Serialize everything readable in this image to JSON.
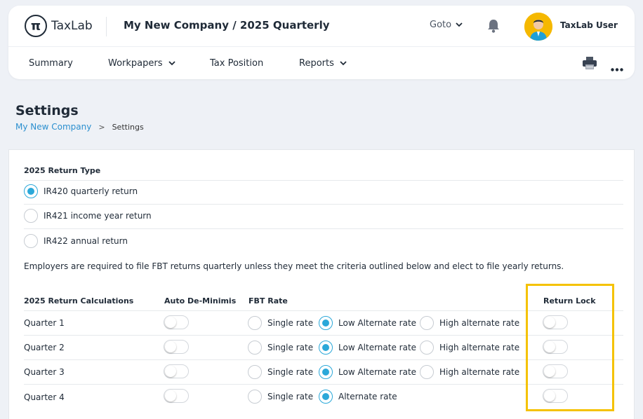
{
  "header": {
    "logo_text": "TaxLab",
    "logo_glyph": "π",
    "company_title": "My New Company / 2025 Quarterly",
    "goto_label": "Goto",
    "user_name": "TaxLab User",
    "avatar_color": "#f5b800"
  },
  "nav": {
    "items": [
      {
        "label": "Summary",
        "has_dropdown": false
      },
      {
        "label": "Workpapers",
        "has_dropdown": true
      },
      {
        "label": "Tax Position",
        "has_dropdown": false
      },
      {
        "label": "Reports",
        "has_dropdown": true
      }
    ],
    "icons": [
      "printer-icon",
      "more-icon"
    ]
  },
  "page": {
    "title": "Settings",
    "breadcrumb": {
      "link": "My New Company",
      "separator": ">",
      "current": "Settings"
    }
  },
  "return_type": {
    "title": "2025 Return Type",
    "options": [
      {
        "label": "IR420 quarterly return",
        "selected": true
      },
      {
        "label": "IR421 income year return",
        "selected": false
      },
      {
        "label": "IR422 annual return",
        "selected": false
      }
    ],
    "note": "Employers are required to file FBT returns quarterly unless they meet the criteria outlined below and elect to file yearly returns."
  },
  "calculations": {
    "headers": {
      "name": "2025 Return Calculations",
      "auto": "Auto De-Minimis",
      "rate": "FBT Rate",
      "lock": "Return Lock"
    },
    "rows": [
      {
        "name": "Quarter 1",
        "auto_on": false,
        "options": [
          {
            "label": "Single rate",
            "selected": false
          },
          {
            "label": "Low Alternate rate",
            "selected": true
          },
          {
            "label": "High alternate rate",
            "selected": false
          }
        ],
        "lock_on": false
      },
      {
        "name": "Quarter 2",
        "auto_on": false,
        "options": [
          {
            "label": "Single rate",
            "selected": false
          },
          {
            "label": "Low Alternate rate",
            "selected": true
          },
          {
            "label": "High alternate rate",
            "selected": false
          }
        ],
        "lock_on": false
      },
      {
        "name": "Quarter 3",
        "auto_on": false,
        "options": [
          {
            "label": "Single rate",
            "selected": false
          },
          {
            "label": "Low Alternate rate",
            "selected": true
          },
          {
            "label": "High alternate rate",
            "selected": false
          }
        ],
        "lock_on": false
      },
      {
        "name": "Quarter 4",
        "auto_on": false,
        "options": [
          {
            "label": "Single rate",
            "selected": false
          },
          {
            "label": "Alternate rate",
            "selected": true
          }
        ],
        "lock_on": false
      }
    ]
  },
  "colors": {
    "accent": "#2ba8d9",
    "link": "#2b8fcf",
    "highlight": "#f5c200",
    "page_bg": "#eef1f6"
  }
}
